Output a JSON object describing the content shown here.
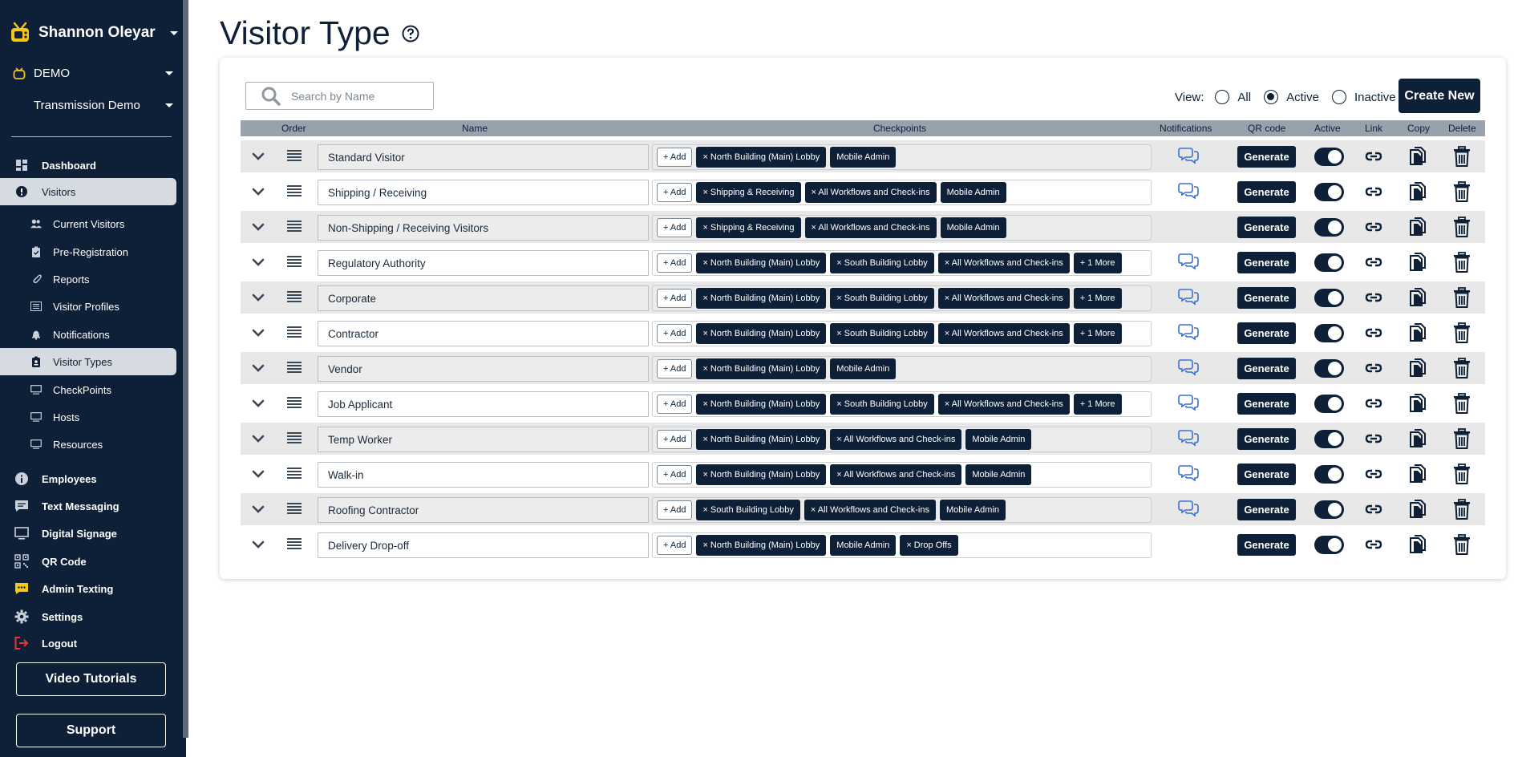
{
  "sidebar": {
    "user_name": "Shannon Oleyar",
    "org_name": "DEMO",
    "site_name": "Transmission Demo",
    "nav": [
      {
        "label": "Dashboard",
        "icon": "dashboard-icon"
      },
      {
        "label": "Visitors",
        "icon": "info-icon"
      },
      {
        "label": "Current Visitors",
        "icon": "people-icon"
      },
      {
        "label": "Pre-Registration",
        "icon": "clipboard-icon"
      },
      {
        "label": "Reports",
        "icon": "paperclip-icon"
      },
      {
        "label": "Visitor Profiles",
        "icon": "list-icon"
      },
      {
        "label": "Notifications",
        "icon": "bell-icon"
      },
      {
        "label": "Visitor Types",
        "icon": "badge-icon"
      },
      {
        "label": "CheckPoints",
        "icon": "monitor-icon"
      },
      {
        "label": "Hosts",
        "icon": "monitor-icon"
      },
      {
        "label": "Resources",
        "icon": "monitor-icon"
      },
      {
        "label": "Employees",
        "icon": "info-icon"
      },
      {
        "label": "Text Messaging",
        "icon": "message-icon"
      },
      {
        "label": "Digital Signage",
        "icon": "monitor-icon"
      },
      {
        "label": "QR Code",
        "icon": "qr-icon"
      },
      {
        "label": "Admin Texting",
        "icon": "chat-icon"
      },
      {
        "label": "Settings",
        "icon": "gear-icon"
      },
      {
        "label": "Logout",
        "icon": "logout-icon"
      }
    ],
    "video_tutorials": "Video Tutorials",
    "support": "Support",
    "accent_yellow": "#f5c518",
    "logout_red": "#e53935"
  },
  "page": {
    "title": "Visitor Type"
  },
  "toolbar": {
    "search_placeholder": "Search by Name",
    "view_label": "View:",
    "view_options": [
      "All",
      "Active",
      "Inactive"
    ],
    "view_selected": "Active",
    "create_new": "Create New"
  },
  "table": {
    "headers": {
      "order": "Order",
      "name": "Name",
      "checkpoints": "Checkpoints",
      "notifications": "Notifications",
      "qr_code": "QR code",
      "active": "Active",
      "link": "Link",
      "copy": "Copy",
      "delete": "Delete"
    },
    "add_label": "+ Add",
    "generate_label": "Generate",
    "rows": [
      {
        "name": "Standard Visitor",
        "checkpoints": [
          "× North Building (Main) Lobby",
          "Mobile Admin"
        ],
        "notifications": true
      },
      {
        "name": "Shipping / Receiving",
        "checkpoints": [
          "× Shipping & Receiving",
          "× All Workflows and Check-ins",
          "Mobile Admin"
        ],
        "notifications": true
      },
      {
        "name": "Non-Shipping / Receiving Visitors",
        "checkpoints": [
          "× Shipping & Receiving",
          "× All Workflows and Check-ins",
          "Mobile Admin"
        ],
        "notifications": false
      },
      {
        "name": "Regulatory Authority",
        "checkpoints": [
          "× North Building (Main) Lobby",
          "× South Building Lobby",
          "× All Workflows and Check-ins",
          "+ 1 More"
        ],
        "notifications": true
      },
      {
        "name": "Corporate",
        "checkpoints": [
          "× North Building (Main) Lobby",
          "× South Building Lobby",
          "× All Workflows and Check-ins",
          "+ 1 More"
        ],
        "notifications": true
      },
      {
        "name": "Contractor",
        "checkpoints": [
          "× North Building (Main) Lobby",
          "× South Building Lobby",
          "× All Workflows and Check-ins",
          "+ 1 More"
        ],
        "notifications": true
      },
      {
        "name": "Vendor",
        "checkpoints": [
          "× North Building (Main) Lobby",
          "Mobile Admin"
        ],
        "notifications": true
      },
      {
        "name": "Job Applicant",
        "checkpoints": [
          "× North Building (Main) Lobby",
          "× South Building Lobby",
          "× All Workflows and Check-ins",
          "+ 1 More"
        ],
        "notifications": true
      },
      {
        "name": "Temp Worker",
        "checkpoints": [
          "× North Building (Main) Lobby",
          "× All Workflows and Check-ins",
          "Mobile Admin"
        ],
        "notifications": true
      },
      {
        "name": "Walk-in",
        "checkpoints": [
          "× North Building (Main) Lobby",
          "× All Workflows and Check-ins",
          "Mobile Admin"
        ],
        "notifications": true
      },
      {
        "name": "Roofing Contractor",
        "checkpoints": [
          "× South Building Lobby",
          "× All Workflows and Check-ins",
          "Mobile Admin"
        ],
        "notifications": true
      },
      {
        "name": "Delivery Drop-off",
        "checkpoints": [
          "× North Building (Main) Lobby",
          "Mobile Admin",
          "× Drop Offs"
        ],
        "notifications": false
      }
    ]
  }
}
